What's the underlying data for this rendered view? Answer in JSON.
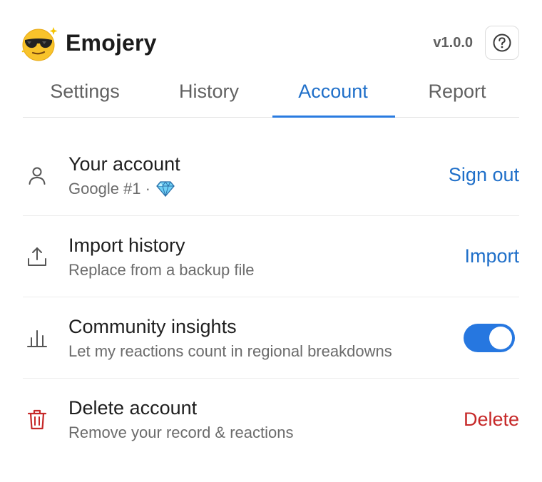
{
  "app": {
    "title": "Emojery",
    "version": "v1.0.0",
    "logo_icon": "sunglasses-emoji-icon",
    "help_icon": "question-circle-icon"
  },
  "tabs": [
    {
      "label": "Settings",
      "active": false
    },
    {
      "label": "History",
      "active": false
    },
    {
      "label": "Account",
      "active": true
    },
    {
      "label": "Report",
      "active": false
    }
  ],
  "rows": [
    {
      "icon": "user-icon",
      "title": "Your account",
      "subtitle": "Google #1 ·",
      "subtitle_icon": "gem-icon",
      "action": "Sign out"
    },
    {
      "icon": "upload-icon",
      "title": "Import history",
      "subtitle": "Replace from a backup file",
      "action": "Import"
    },
    {
      "icon": "bar-chart-icon",
      "title": "Community insights",
      "subtitle": "Let my reactions count in regional breakdowns",
      "toggle_on": true
    },
    {
      "icon": "trash-icon",
      "title": "Delete account",
      "subtitle": "Remove your record & reactions",
      "action": "Delete"
    }
  ],
  "colors": {
    "accent": "#1f6fc9",
    "toggle": "#2677e0",
    "danger": "#c62828"
  }
}
